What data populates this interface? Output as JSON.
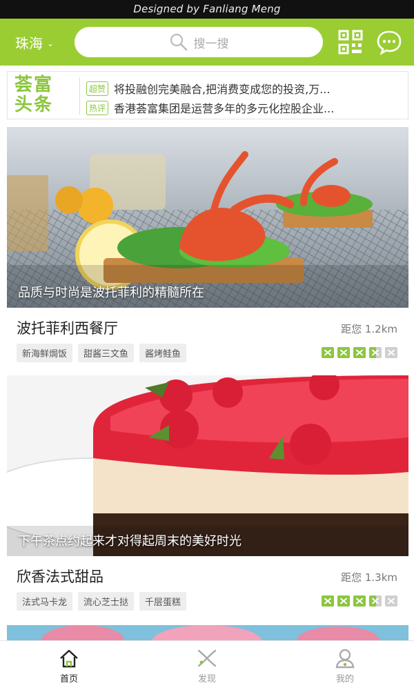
{
  "topbar": {
    "credit": "Designed by Fanliang Meng"
  },
  "header": {
    "city": "珠海",
    "search_placeholder": "搜一搜",
    "icons": [
      "qr-code-icon",
      "chat-bubble-icon"
    ]
  },
  "news": {
    "logo_line1": "荟富",
    "logo_line2": "头条",
    "items": [
      {
        "tag": "超赞",
        "text": "将投融创完美融合,把消费变成您的投资,万..."
      },
      {
        "tag": "热评",
        "text": "香港荟富集团是运营多年的多元化控股企业..."
      }
    ]
  },
  "cards": [
    {
      "caption": "品质与时尚是波托菲利的精髓所在",
      "title": "波托菲利西餐厅",
      "distance": "距您 1.2km",
      "tags": [
        "新海鲜焗饭",
        "甜酱三文鱼",
        "酱烤鲑鱼"
      ],
      "rating": 3.5
    },
    {
      "caption": "下午茶点约起来才对得起周末的美好时光",
      "title": "欣香法式甜品",
      "distance": "距您 1.3km",
      "tags": [
        "法式马卡龙",
        "流心芝士挞",
        "千层蛋糕"
      ],
      "rating": 3.5
    }
  ],
  "tabbar": {
    "items": [
      {
        "label": "首页",
        "icon": "home-icon",
        "active": true
      },
      {
        "label": "发现",
        "icon": "discover-icon",
        "active": false
      },
      {
        "label": "我的",
        "icon": "profile-icon",
        "active": false
      }
    ]
  },
  "colors": {
    "brand": "#9acd32",
    "accent": "#8cc63f",
    "topbar": "#111111"
  }
}
